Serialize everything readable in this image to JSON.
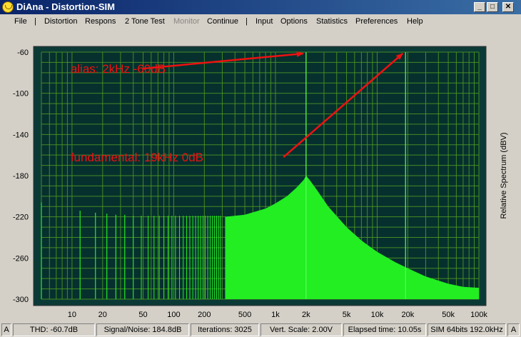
{
  "window": {
    "title": "DiAna - Distortion-SIM",
    "controls": {
      "minimize": "_",
      "maximize": "□",
      "close": "✕"
    }
  },
  "menu": {
    "items": [
      {
        "label": "File",
        "enabled": true
      },
      {
        "label": "|",
        "separator": true
      },
      {
        "label": "Distortion",
        "enabled": true
      },
      {
        "label": "Respons",
        "enabled": true
      },
      {
        "label": "2 Tone Test",
        "enabled": true
      },
      {
        "label": "Monitor",
        "enabled": false
      },
      {
        "label": "Continue",
        "enabled": true
      },
      {
        "label": "|",
        "separator": true
      },
      {
        "label": "Input",
        "enabled": true
      },
      {
        "label": "Options",
        "enabled": true
      },
      {
        "label": "Statistics",
        "enabled": true
      },
      {
        "label": "Preferences",
        "enabled": true
      },
      {
        "label": "Help",
        "enabled": true
      }
    ]
  },
  "chart_data": {
    "type": "line",
    "title": "",
    "xlabel": "",
    "ylabel": "Relative Spectrum (dBV)",
    "x_scale": "log",
    "xlim": [
      5,
      100000
    ],
    "ylim": [
      -300,
      -60
    ],
    "x_ticks": [
      {
        "value": 10,
        "label": "10"
      },
      {
        "value": 20,
        "label": "20"
      },
      {
        "value": 50,
        "label": "50"
      },
      {
        "value": 100,
        "label": "100"
      },
      {
        "value": 200,
        "label": "200"
      },
      {
        "value": 500,
        "label": "500"
      },
      {
        "value": 1000,
        "label": "1k"
      },
      {
        "value": 2000,
        "label": "2k"
      },
      {
        "value": 5000,
        "label": "5k"
      },
      {
        "value": 10000,
        "label": "10k"
      },
      {
        "value": 20000,
        "label": "20k"
      },
      {
        "value": 50000,
        "label": "50k"
      },
      {
        "value": 100000,
        "label": "100k"
      }
    ],
    "y_ticks": [
      -60,
      -100,
      -140,
      -180,
      -220,
      -260,
      -300
    ],
    "grid": true,
    "background": "#06302e",
    "grid_color": "#4f9a22",
    "fill_color": "#22ee22",
    "spectrum": {
      "noise_floor_db": -222,
      "envelope": [
        [
          5,
          -222
        ],
        [
          300,
          -220
        ],
        [
          500,
          -218
        ],
        [
          800,
          -212
        ],
        [
          1000,
          -207
        ],
        [
          1300,
          -200
        ],
        [
          1600,
          -192
        ],
        [
          1900,
          -184
        ],
        [
          2000,
          -180
        ],
        [
          2200,
          -185
        ],
        [
          2600,
          -195
        ],
        [
          3300,
          -210
        ],
        [
          5000,
          -230
        ],
        [
          7000,
          -243
        ],
        [
          10000,
          -254
        ],
        [
          15000,
          -264
        ],
        [
          20000,
          -270
        ],
        [
          30000,
          -278
        ],
        [
          50000,
          -285
        ],
        [
          70000,
          -288
        ],
        [
          100000,
          -289
        ]
      ],
      "discrete_lines": [
        {
          "f": 5,
          "db": -206
        },
        {
          "f": 12,
          "db": -214
        },
        {
          "f": 17,
          "db": -216
        },
        {
          "f": 22,
          "db": -217
        },
        {
          "f": 27,
          "db": -218
        },
        {
          "f": 33,
          "db": -218
        }
      ],
      "peaks": [
        {
          "f": 2000,
          "db": -60
        },
        {
          "f": 19000,
          "db": -60
        }
      ]
    },
    "annotations": [
      {
        "text": "alias: 2kHz  -60dB",
        "color": "#ee1111",
        "text_x_hz": 7,
        "text_y_db": -76,
        "arrow_from_hz": 50,
        "arrow_from_db": -76,
        "arrow_to_hz": 2000,
        "arrow_to_db": -60
      },
      {
        "text": "fundamental: 19kHz  0dB",
        "color": "#ee1111",
        "text_x_hz": 7,
        "text_y_db": -162,
        "arrow_from_hz": 1200,
        "arrow_from_db": -162,
        "arrow_to_hz": 19000,
        "arrow_to_db": -60
      }
    ]
  },
  "status": {
    "cells": [
      {
        "name": "mode-a",
        "text": "A"
      },
      {
        "name": "thd",
        "text": "THD:  -60.7dB"
      },
      {
        "name": "signal-noise",
        "text": "Signal/Noise:  184.8dB"
      },
      {
        "name": "iterations",
        "text": "Iterations: 3025"
      },
      {
        "name": "vert-scale",
        "text": "Vert. Scale: 2.00V"
      },
      {
        "name": "elapsed",
        "text": "Elapsed time: 10.05s"
      },
      {
        "name": "sim-info",
        "text": "SIM 64bits 192.0kHz"
      },
      {
        "name": "mode-a-right",
        "text": "A"
      }
    ]
  }
}
